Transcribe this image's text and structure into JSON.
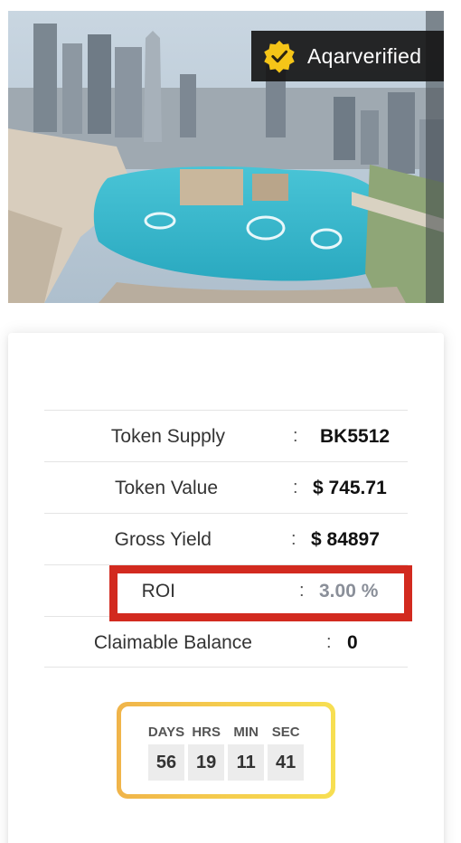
{
  "hero": {
    "badge_icon": "verified-check-icon",
    "badge_label": "Aqarverified",
    "badge_color": "#f5c518"
  },
  "details": {
    "rows": [
      {
        "label": "Token Supply",
        "value": "BK5512"
      },
      {
        "label": "Token Value",
        "value": "$ 745.71"
      },
      {
        "label": "Gross Yield",
        "value": "$ 84897"
      },
      {
        "label": "ROI",
        "value": "3.00 %"
      },
      {
        "label": "Claimable Balance",
        "value": "0"
      }
    ],
    "separator": ":",
    "highlight_color": "#d22a1f"
  },
  "countdown": {
    "units": [
      {
        "label": "DAYS",
        "value": "56"
      },
      {
        "label": "HRS",
        "value": "19"
      },
      {
        "label": "MIN",
        "value": "11"
      },
      {
        "label": "SEC",
        "value": "41"
      }
    ]
  }
}
